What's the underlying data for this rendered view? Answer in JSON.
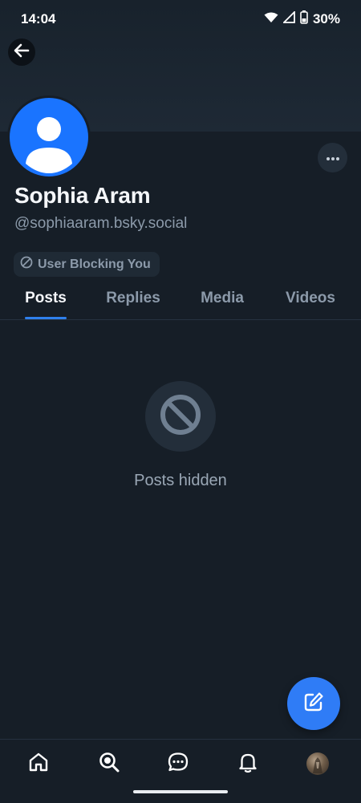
{
  "status_bar": {
    "time": "14:04",
    "battery": "30%",
    "icons": [
      "wifi-icon",
      "signal-icon",
      "battery-icon"
    ]
  },
  "header": {
    "back_icon": "arrow-left-icon",
    "more_icon": "ellipsis-icon"
  },
  "profile": {
    "display_name": "Sophia Aram",
    "handle": "@sophiaaram.bsky.social",
    "badge": "User Blocking You",
    "avatar_color": "#1a74ff"
  },
  "tabs": [
    {
      "label": "Posts",
      "active": true
    },
    {
      "label": "Replies",
      "active": false
    },
    {
      "label": "Media",
      "active": false
    },
    {
      "label": "Videos",
      "active": false
    }
  ],
  "empty_state": {
    "icon": "blocked-circle-icon",
    "message": "Posts hidden"
  },
  "fab": {
    "icon": "compose-icon",
    "color": "#2f7cf6"
  },
  "bottom_nav": [
    {
      "name": "home",
      "icon": "home-icon"
    },
    {
      "name": "search",
      "icon": "search-icon"
    },
    {
      "name": "chat",
      "icon": "chat-icon"
    },
    {
      "name": "notifications",
      "icon": "bell-icon"
    },
    {
      "name": "profile",
      "icon": "avatar-icon"
    }
  ],
  "colors": {
    "background": "#161e27",
    "accent": "#2f80ed",
    "muted_text": "#8c9aaa"
  }
}
